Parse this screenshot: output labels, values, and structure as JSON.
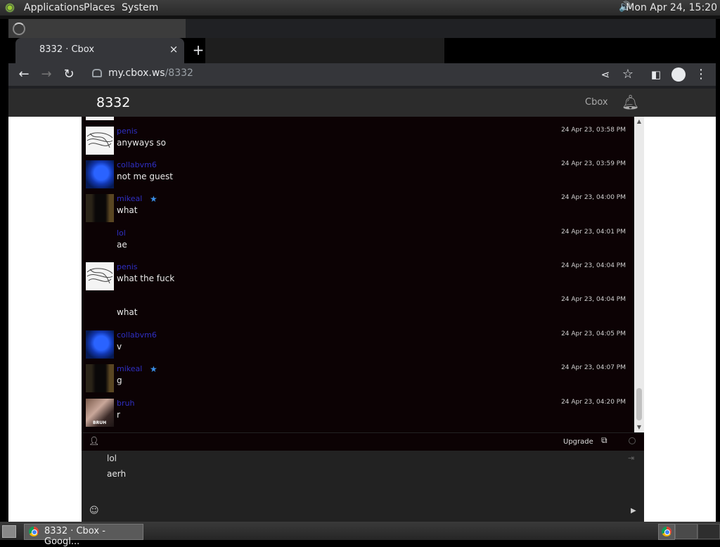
{
  "panel": {
    "menus": [
      "Applications",
      "Places",
      "System"
    ],
    "clock": "Mon Apr 24, 15:20"
  },
  "browser": {
    "tab_title": "8332 · Cbox",
    "close_glyph": "×",
    "newtab_glyph": "+",
    "url_host": "my.cbox.ws",
    "url_path": "/8332"
  },
  "page": {
    "room_title": "8332",
    "brand_link": "Cbox"
  },
  "messages": [
    {
      "user": "penis",
      "star": false,
      "avatar": "sketch",
      "text": "anyways so",
      "time": "24 Apr 23, 03:58 PM"
    },
    {
      "user": "collabvm6",
      "star": false,
      "avatar": "blue",
      "text": "not me guest",
      "time": "24 Apr 23, 03:59 PM"
    },
    {
      "user": "mikeal",
      "star": true,
      "avatar": "dark",
      "text": "what",
      "time": "24 Apr 23, 04:00 PM"
    },
    {
      "user": "lol",
      "star": false,
      "avatar": "none",
      "text": "ae",
      "time": "24 Apr 23, 04:01 PM"
    },
    {
      "user": "penis",
      "star": false,
      "avatar": "sketch",
      "text": "what the fuck",
      "time": "24 Apr 23, 04:04 PM"
    },
    {
      "user": "",
      "star": false,
      "avatar": "none",
      "text": "what",
      "time": "24 Apr 23, 04:04 PM"
    },
    {
      "user": "collabvm6",
      "star": false,
      "avatar": "blue",
      "text": "v",
      "time": "24 Apr 23, 04:05 PM"
    },
    {
      "user": "mikeal",
      "star": true,
      "avatar": "dark",
      "text": "g",
      "time": "24 Apr 23, 04:07 PM"
    },
    {
      "user": "bruh",
      "star": false,
      "avatar": "bruh",
      "text": "r",
      "time": "24 Apr 23, 04:20 PM"
    }
  ],
  "avatar_caption": "BRUH",
  "chat_bar": {
    "upgrade_label": "Upgrade"
  },
  "input": {
    "name_value": "lol",
    "message_value": "aerh"
  },
  "taskbar": {
    "window_button": "8332 · Cbox - Googl..."
  }
}
